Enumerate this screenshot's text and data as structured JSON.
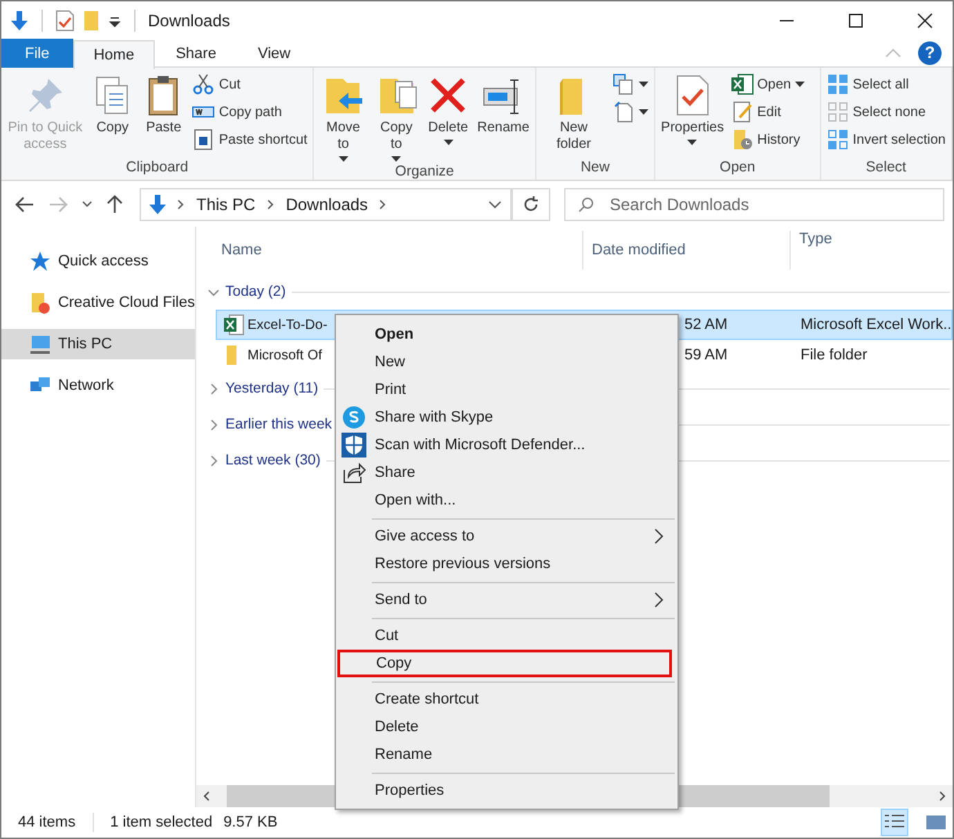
{
  "window": {
    "title": "Downloads"
  },
  "tabs": [
    {
      "label": "File",
      "kind": "file",
      "selected": false
    },
    {
      "label": "Home",
      "kind": "tab",
      "selected": true
    },
    {
      "label": "Share",
      "kind": "tab",
      "selected": false
    },
    {
      "label": "View",
      "kind": "tab",
      "selected": false
    }
  ],
  "help": "?",
  "ribbon": {
    "groups": [
      {
        "label": "Clipboard",
        "large": [
          {
            "label": "Pin to Quick access",
            "kind": "pin",
            "disabled": true
          },
          {
            "label": "Copy",
            "kind": "copy",
            "disabled": false
          },
          {
            "label": "Paste",
            "kind": "paste",
            "disabled": false
          }
        ],
        "small": [
          {
            "label": "Cut",
            "kind": "cut"
          },
          {
            "label": "Copy path",
            "kind": "path"
          },
          {
            "label": "Paste shortcut",
            "kind": "shortcut"
          }
        ]
      },
      {
        "label": "Organize",
        "large": [
          {
            "label": "Move to",
            "kind": "move",
            "disabled": false,
            "dropdown": true
          },
          {
            "label": "Copy to",
            "kind": "copyto",
            "disabled": false,
            "dropdown": true
          },
          {
            "label": "Delete",
            "kind": "delete",
            "disabled": false,
            "dropdown": true
          },
          {
            "label": "Rename",
            "kind": "rename",
            "disabled": false,
            "dropdown": false
          }
        ]
      },
      {
        "label": "New",
        "large": [
          {
            "label": "New folder",
            "kind": "folder",
            "disabled": false
          }
        ],
        "small": [
          {
            "kind": "newitem",
            "dropdown": true
          },
          {
            "kind": "easyaccess",
            "dropdown": true
          }
        ]
      },
      {
        "label": "Open",
        "large": [
          {
            "label": "Properties",
            "kind": "properties",
            "disabled": false,
            "dropdown": true
          }
        ],
        "small": [
          {
            "label": "Open",
            "kind": "excel",
            "dropdown": true
          },
          {
            "label": "Edit",
            "kind": "edit",
            "dropdown": false
          },
          {
            "label": "History",
            "kind": "history",
            "dropdown": false
          }
        ]
      },
      {
        "label": "Select",
        "small": [
          {
            "label": "Select all",
            "kind": "selall"
          },
          {
            "label": "Select none",
            "kind": "selnone"
          },
          {
            "label": "Invert selection",
            "kind": "invert"
          }
        ]
      }
    ]
  },
  "address": {
    "path": [
      "This PC",
      "Downloads"
    ]
  },
  "search": {
    "placeholder": "Search Downloads"
  },
  "sidebar": {
    "items": [
      {
        "label": "Quick access",
        "kind": "star",
        "selected": false
      },
      {
        "label": "Creative Cloud Files",
        "kind": "cc",
        "selected": false
      },
      {
        "label": "This PC",
        "kind": "pc",
        "selected": true
      },
      {
        "label": "Network",
        "kind": "network",
        "selected": false
      }
    ]
  },
  "table": {
    "columns": [
      "Name",
      "Date modified",
      "Type"
    ],
    "groups": [
      {
        "label": "Today (2)",
        "expanded": true,
        "rows": [
          {
            "name": "Excel-To-Do-",
            "kind": "excel",
            "date": "52 AM",
            "type": "Microsoft Excel Work...",
            "selected": true
          },
          {
            "name": "Microsoft Of",
            "kind": "folder",
            "date": "59 AM",
            "type": "File folder",
            "selected": false
          }
        ]
      },
      {
        "label": "Yesterday (11)",
        "expanded": false
      },
      {
        "label": "Earlier this week",
        "expanded": false
      },
      {
        "label": "Last week (30)",
        "expanded": false
      }
    ]
  },
  "context_menu": {
    "items": [
      {
        "kind": "item",
        "label": "Open",
        "bold": true
      },
      {
        "kind": "item",
        "label": "New"
      },
      {
        "kind": "item",
        "label": "Print"
      },
      {
        "kind": "skype",
        "label": "Share with Skype"
      },
      {
        "kind": "shield",
        "label": "Scan with Microsoft Defender..."
      },
      {
        "kind": "share",
        "label": "Share"
      },
      {
        "kind": "item",
        "label": "Open with..."
      },
      {
        "kind": "separator"
      },
      {
        "kind": "item",
        "label": "Give access to",
        "submenu": true
      },
      {
        "kind": "item",
        "label": "Restore previous versions"
      },
      {
        "kind": "separator"
      },
      {
        "kind": "item",
        "label": "Send to",
        "submenu": true
      },
      {
        "kind": "separator"
      },
      {
        "kind": "item",
        "label": "Cut"
      },
      {
        "kind": "item",
        "label": "Copy",
        "highlighted": true
      },
      {
        "kind": "separator"
      },
      {
        "kind": "item",
        "label": "Create shortcut"
      },
      {
        "kind": "item",
        "label": "Delete"
      },
      {
        "kind": "item",
        "label": "Rename"
      },
      {
        "kind": "separator"
      },
      {
        "kind": "item",
        "label": "Properties"
      }
    ]
  },
  "status_bar": {
    "items": [
      "44 items",
      "1 item selected",
      "9.57 KB"
    ],
    "views": [
      {
        "kind": "details",
        "selected": true
      },
      {
        "kind": "large",
        "selected": false
      }
    ]
  }
}
